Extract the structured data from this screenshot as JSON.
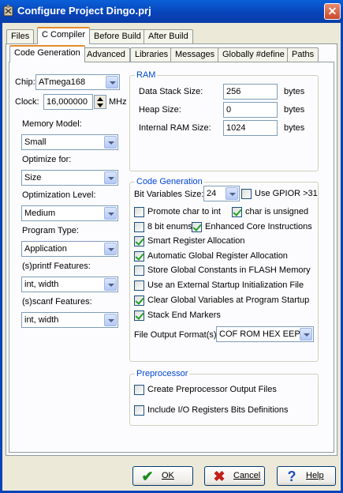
{
  "window": {
    "title": "Configure Project Dingo.prj",
    "close_glyph": "✕"
  },
  "top_tabs": [
    {
      "label": "Files"
    },
    {
      "label": "C Compiler"
    },
    {
      "label": "Before Build"
    },
    {
      "label": "After Build"
    }
  ],
  "sub_tabs": [
    {
      "label": "Code Generation"
    },
    {
      "label": "Advanced"
    },
    {
      "label": "Libraries"
    },
    {
      "label": "Messages"
    },
    {
      "label": "Globally #define"
    },
    {
      "label": "Paths"
    }
  ],
  "left": {
    "chip_label": "Chip:",
    "chip_value": "ATmega168",
    "clock_label": "Clock:",
    "clock_value": "16,000000",
    "clock_unit": "MHz",
    "memory_model_label": "Memory Model:",
    "memory_model_value": "Small",
    "optimize_for_label": "Optimize for:",
    "optimize_for_value": "Size",
    "optimization_level_label": "Optimization Level:",
    "optimization_level_value": "Medium",
    "program_type_label": "Program Type:",
    "program_type_value": "Application",
    "printf_label": "(s)printf Features:",
    "printf_value": "int, width",
    "scanf_label": "(s)scanf Features:",
    "scanf_value": "int, width"
  },
  "ram": {
    "title": "RAM",
    "data_stack_label": "Data Stack Size:",
    "data_stack_value": "256",
    "heap_label": "Heap Size:",
    "heap_value": "0",
    "internal_ram_label": "Internal RAM Size:",
    "internal_ram_value": "1024",
    "unit": "bytes"
  },
  "codegen": {
    "title": "Code Generation",
    "bit_vars_label": "Bit Variables Size:",
    "bit_vars_value": "24",
    "use_gpior_label": "Use GPIOR >31",
    "promote_char_label": "Promote char to int",
    "char_unsigned_label": "char is unsigned",
    "bit_enums_label": "8 bit enums",
    "enhanced_core_label": "Enhanced Core Instructions",
    "smart_reg_label": "Smart Register Allocation",
    "auto_global_reg_label": "Automatic Global Register Allocation",
    "store_flash_label": "Store Global Constants in FLASH Memory",
    "ext_startup_label": "Use an External Startup Initialization File",
    "clear_globals_label": "Clear Global Variables at Program Startup",
    "stack_end_label": "Stack End Markers",
    "file_output_label": "File Output Format(s):",
    "file_output_value": "COF ROM HEX EEP"
  },
  "preprocessor": {
    "title": "Preprocessor",
    "create_output_label": "Create Preprocessor Output Files",
    "include_io_label": "Include I/O Registers Bits Definitions"
  },
  "buttons": {
    "ok": "OK",
    "cancel": "Cancel",
    "help": "Help"
  },
  "checks": {
    "use_gpior": false,
    "promote_char": false,
    "char_unsigned": true,
    "bit_enums": false,
    "enhanced_core": true,
    "smart_reg": true,
    "auto_global_reg": true,
    "store_flash": false,
    "ext_startup": false,
    "clear_globals": true,
    "stack_end": true,
    "create_output": false,
    "include_io": false
  },
  "colors": {
    "title_bar": "#0843b8",
    "group_title": "#0046d5",
    "check_mark": "#21a121",
    "tab_highlight": "#e68b2c",
    "ok_glyph": "#1a8a1a",
    "cancel_glyph": "#c0201a",
    "help_glyph": "#1a4fc0"
  }
}
